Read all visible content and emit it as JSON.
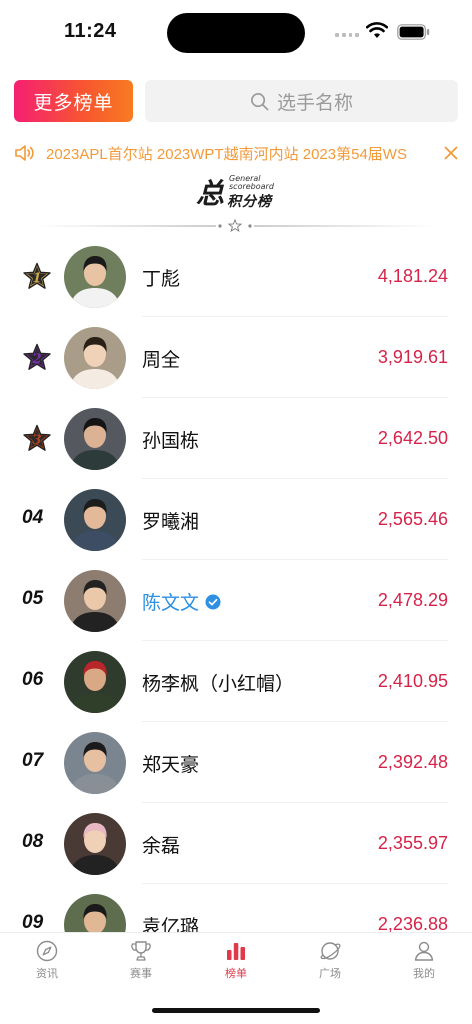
{
  "status": {
    "time": "11:24"
  },
  "top": {
    "more_label": "更多榜单",
    "search_placeholder": "选手名称"
  },
  "notice": {
    "text": "2023APL首尔站  2023WPT越南河内站  2023第54届WS"
  },
  "heading": {
    "main": "总",
    "en_line1": "General",
    "en_line2": "scoreboard",
    "cn": "积分榜"
  },
  "colors": {
    "accent": "#e0394a",
    "score": "#d6234a",
    "link": "#2f8fe0",
    "notice": "#f29a3a",
    "gold": "#c9a44a",
    "purple": "#7b2fb0",
    "bronze": "#b3411d"
  },
  "players": [
    {
      "rank": "1",
      "name": "丁彪",
      "score": "4,181.24"
    },
    {
      "rank": "2",
      "name": "周全",
      "score": "3,919.61"
    },
    {
      "rank": "3",
      "name": "孙国栋",
      "score": "2,642.50"
    },
    {
      "rank": "04",
      "name": "罗曦湘",
      "score": "2,565.46"
    },
    {
      "rank": "05",
      "name": "陈文文",
      "score": "2,478.29",
      "verified": true
    },
    {
      "rank": "06",
      "name": "杨李枫（小红帽）",
      "score": "2,410.95"
    },
    {
      "rank": "07",
      "name": "郑天豪",
      "score": "2,392.48"
    },
    {
      "rank": "08",
      "name": "余磊",
      "score": "2,355.97"
    },
    {
      "rank": "09",
      "name": "袁亿璐",
      "score": "2,236.88"
    }
  ],
  "tabs": [
    {
      "label": "资讯",
      "icon": "compass-icon"
    },
    {
      "label": "赛事",
      "icon": "trophy-icon"
    },
    {
      "label": "榜单",
      "icon": "bar-chart-icon",
      "active": true
    },
    {
      "label": "广场",
      "icon": "planet-icon"
    },
    {
      "label": "我的",
      "icon": "person-icon"
    }
  ]
}
